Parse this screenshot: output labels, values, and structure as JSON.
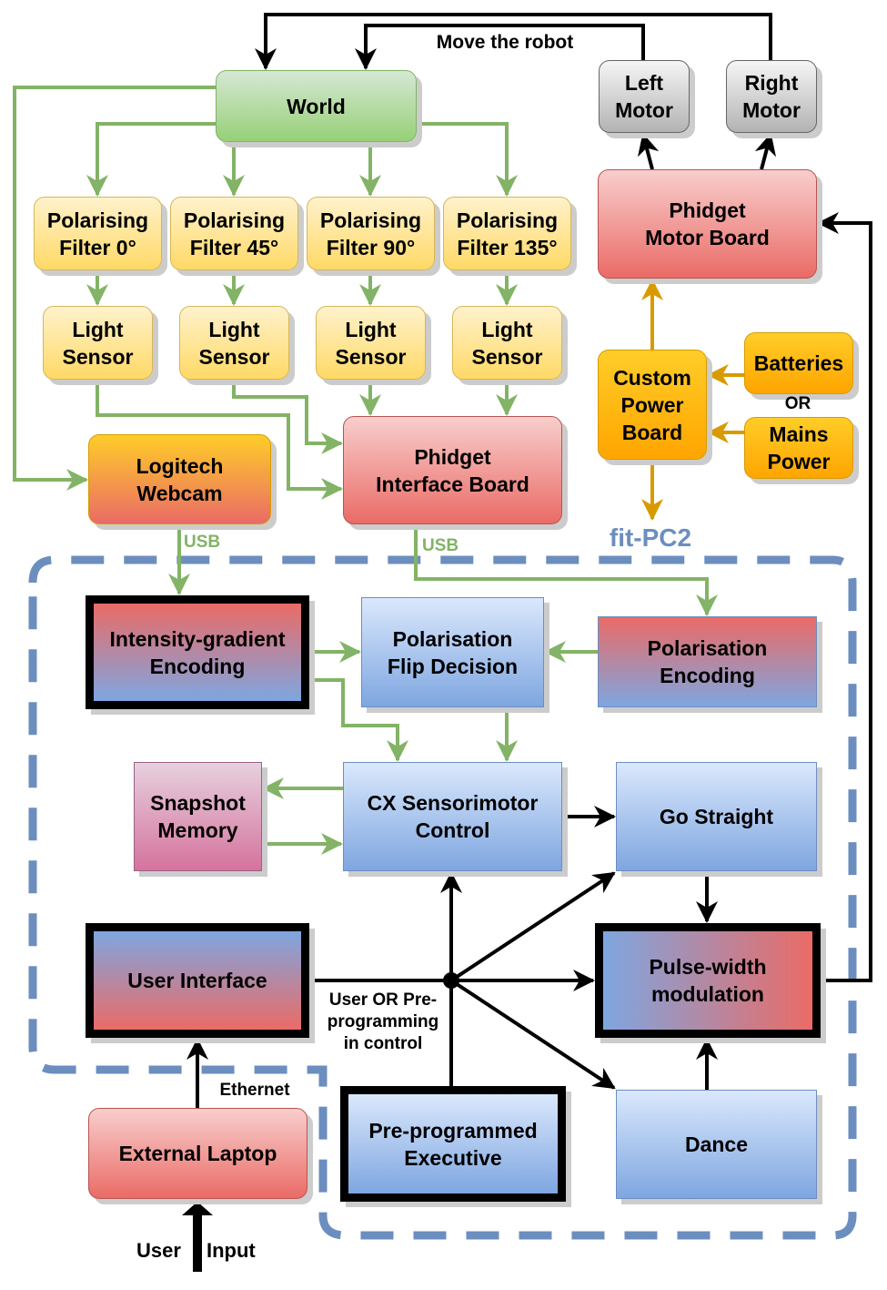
{
  "colors": {
    "green": "#82b366",
    "orange": "#d79b00",
    "boundary": "#6c8ebf",
    "black": "#000000"
  },
  "nodes": {
    "world": "World",
    "filter0": "Polarising\nFilter 0°",
    "filter45": "Polarising\nFilter 45°",
    "filter90": "Polarising\nFilter 90°",
    "filter135": "Polarising\nFilter 135°",
    "sensor": "Light\nSensor",
    "left_motor": "Left\nMotor",
    "right_motor": "Right\nMotor",
    "motor_board": "Phidget\nMotor Board",
    "power_board": "Custom\nPower\nBoard",
    "batteries": "Batteries",
    "mains": "Mains\nPower",
    "webcam": "Logitech\nWebcam",
    "interface_board": "Phidget\nInterface Board",
    "intensity": "Intensity-gradient\nEncoding",
    "flip": "Polarisation\nFlip Decision",
    "pol_enc": "Polarisation\nEncoding",
    "snapshot": "Snapshot\nMemory",
    "cx": "CX Sensorimotor\nControl",
    "go_straight": "Go Straight",
    "ui": "User Interface",
    "pwm": "Pulse-width\nmodulation",
    "preprog": "Pre-programmed\nExecutive",
    "dance": "Dance",
    "laptop": "External Laptop"
  },
  "labels": {
    "move": "Move the robot",
    "or": "OR",
    "fitpc": "fit-PC2",
    "usb": "USB",
    "ethernet": "Ethernet",
    "control": "User OR Pre-\nprogramming\nin control",
    "user": "User",
    "input": "Input"
  }
}
